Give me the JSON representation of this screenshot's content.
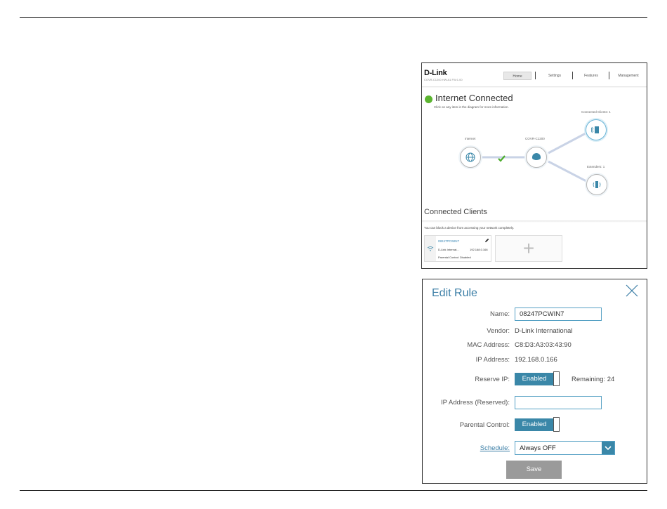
{
  "home": {
    "logo": "D-Link",
    "model_info": "COVR-C1200 HW:A1 FW:1.00",
    "nav": [
      "Home",
      "Settings",
      "Features",
      "Management"
    ],
    "status": "Internet Connected",
    "status_color": "#5cb531",
    "hint": "Click on any item in the diagram for more information.",
    "nodes": {
      "internet": "Internet",
      "router": "COVR-C1200",
      "clients": "Connected Clients: 1",
      "extenders": "Extenders: 1"
    },
    "connected_clients": {
      "title": "Connected Clients",
      "hint": "You can block a device from accessing your network completely.",
      "client": {
        "name": "08247PCWIN7",
        "vendor": "D-Link Internat...",
        "ip": "192.168.0.166",
        "parental": "Parental Control: Disabled"
      },
      "add_symbol": "+"
    }
  },
  "edit_rule": {
    "title": "Edit Rule",
    "name_label": "Name:",
    "name_value": "08247PCWIN7",
    "vendor_label": "Vendor:",
    "vendor_value": "D-Link International",
    "mac_label": "MAC Address:",
    "mac_value": "C8:D3:A3:03:43:90",
    "ip_label": "IP Address:",
    "ip_value": "192.168.0.166",
    "reserve_label": "Reserve IP:",
    "reserve_state": "Enabled",
    "remaining": "Remaining: 24",
    "reserved_ip_label": "IP Address (Reserved):",
    "reserved_ip_value": "",
    "parental_label": "Parental Control:",
    "parental_state": "Enabled",
    "schedule_label": "Schedule:",
    "schedule_value": "Always OFF",
    "save_label": "Save",
    "accent": "#3a87a8"
  }
}
